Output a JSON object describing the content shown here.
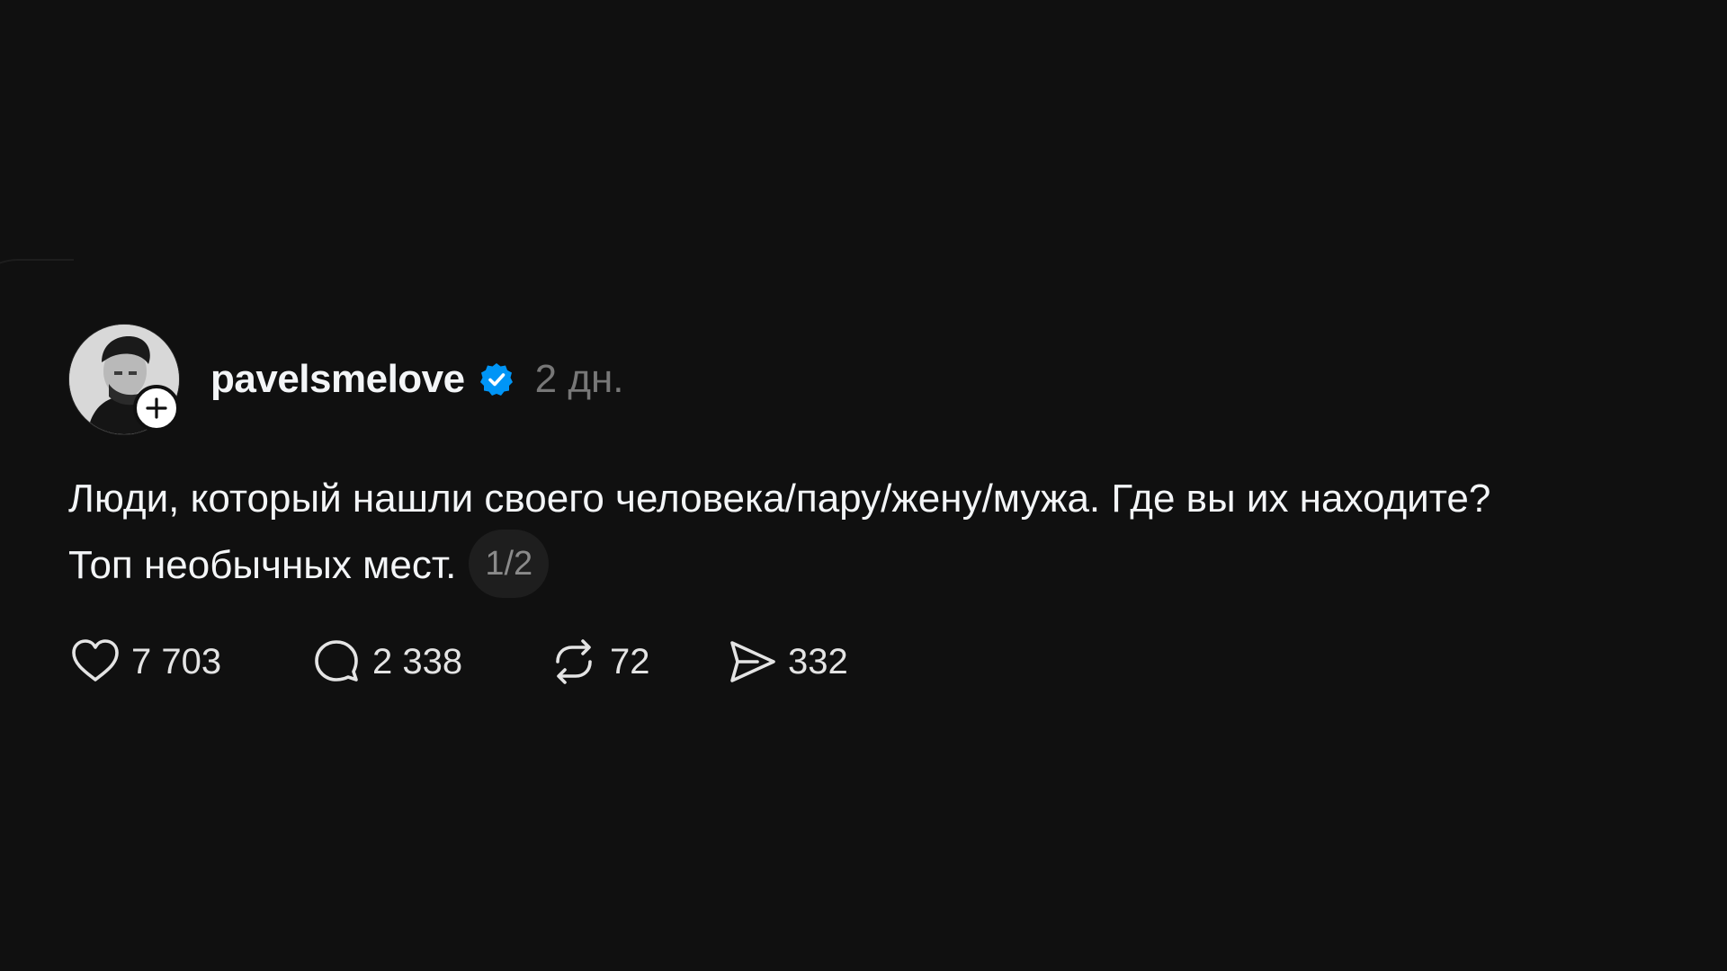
{
  "post": {
    "author": {
      "username": "pavelsmelove",
      "verified": true,
      "avatar_icon": "user-photo-avatar",
      "follow_icon": "plus-icon"
    },
    "time": "2 дн.",
    "text_line1": "Люди, который нашли своего человека/пару/жену/мужа. Где вы их находите?",
    "text_line2": "Топ необычных мест.",
    "pager": "1/2",
    "actions": {
      "likes": "7 703",
      "comments": "2 338",
      "reposts": "72",
      "shares": "332"
    }
  },
  "colors": {
    "background": "#101010",
    "text_primary": "#f3f5f7",
    "text_secondary": "#777777",
    "verified_badge": "#0095f6",
    "pager_bg": "#1e1e1e"
  }
}
